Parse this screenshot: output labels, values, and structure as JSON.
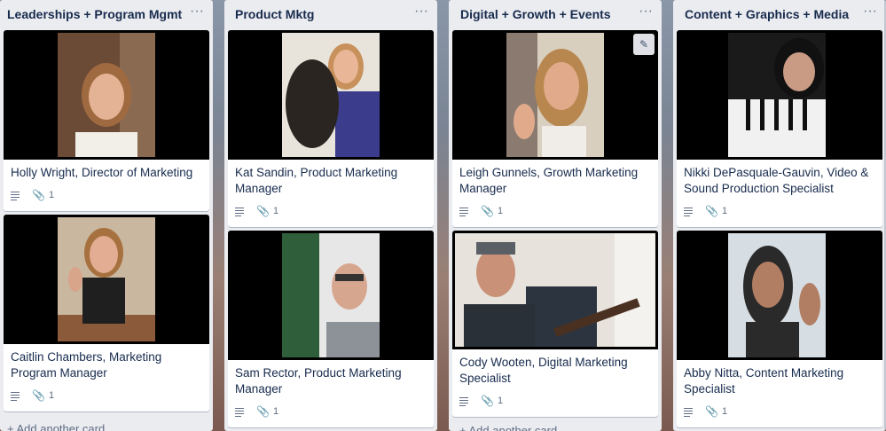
{
  "lists": [
    {
      "title": "Leaderships + Program Mgmt",
      "menu": "···",
      "add_card": "+ Add another card",
      "cards": [
        {
          "title": "Holly Wright, Director of Marketing",
          "attachments": "1",
          "photo_colors": [
            "#6b4a36",
            "#b8886c",
            "#f2efe9"
          ]
        },
        {
          "title": "Caitlin Chambers, Marketing Program Manager",
          "attachments": "1",
          "photo_colors": [
            "#c9b79f",
            "#d8a58a",
            "#1f1f1f"
          ]
        }
      ]
    },
    {
      "title": "Product Mktg",
      "menu": "···",
      "add_card": "",
      "cards": [
        {
          "title": "Kat Sandin, Product Marketing Manager",
          "attachments": "1",
          "photo_colors": [
            "#e8e4dc",
            "#e9b797",
            "#3b3d8c"
          ]
        },
        {
          "title": "Sam Rector, Product Marketing Manager",
          "attachments": "1",
          "photo_colors": [
            "#2f5f3a",
            "#d7a68e",
            "#8c9297"
          ]
        }
      ]
    },
    {
      "title": "Digital + Growth + Events",
      "menu": "···",
      "add_card": "+ Add another card",
      "cards": [
        {
          "title": "Leigh Gunnels, Growth Marketing Manager",
          "attachments": "1",
          "photo_colors": [
            "#d9cfbf",
            "#e1aa8b",
            "#8a7a70"
          ]
        },
        {
          "title": "Cody Wooten, Digital Marketing Specialist",
          "attachments": "1",
          "photo_colors": [
            "#e7e3dc",
            "#c99278",
            "#2c3440"
          ]
        }
      ]
    },
    {
      "title": "Content + Graphics + Media",
      "menu": "···",
      "add_card": "",
      "cards": [
        {
          "title": "Nikki DePasquale-Gauvin, Video & Sound Production Specialist",
          "attachments": "1",
          "photo_colors": [
            "#f1f1f1",
            "#c99b84",
            "#111111"
          ]
        },
        {
          "title": "Abby Nitta, Content Marketing Specialist",
          "attachments": "1",
          "photo_colors": [
            "#d6dde3",
            "#b27e63",
            "#2a2a2a"
          ]
        }
      ]
    }
  ]
}
